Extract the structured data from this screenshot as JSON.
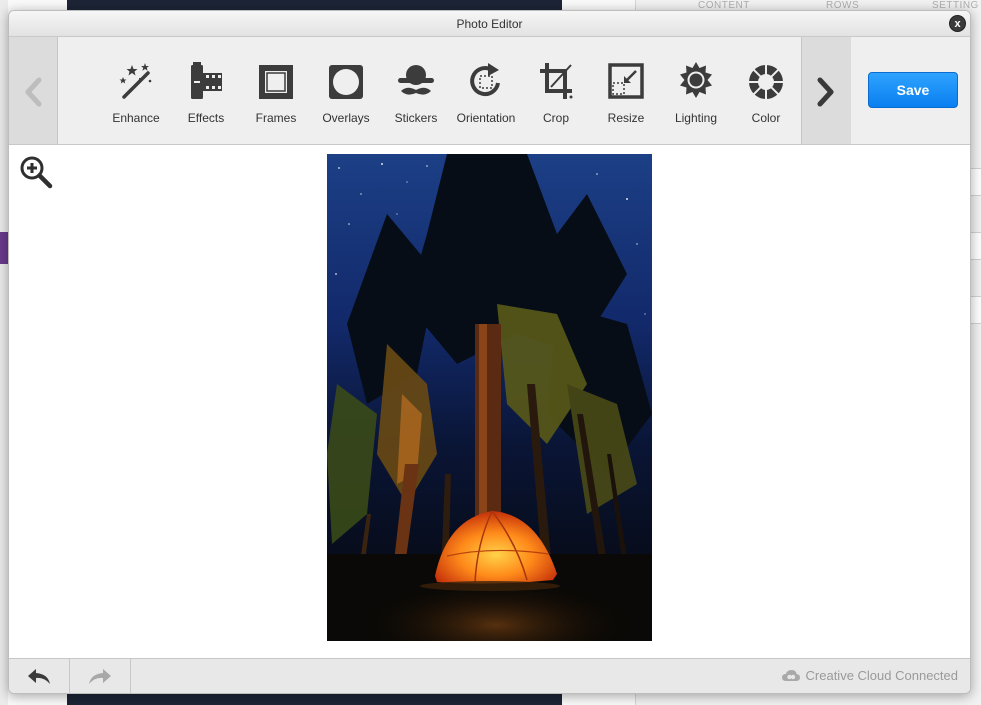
{
  "background": {
    "right_tabs": [
      "CONTENT",
      "ROWS",
      "SETTING"
    ]
  },
  "dialog": {
    "title": "Photo Editor",
    "close_label": "x"
  },
  "toolbar": {
    "tools": [
      {
        "label": "Enhance",
        "icon": "magic-wand-icon"
      },
      {
        "label": "Effects",
        "icon": "film-icon"
      },
      {
        "label": "Frames",
        "icon": "frame-icon"
      },
      {
        "label": "Overlays",
        "icon": "overlay-icon"
      },
      {
        "label": "Stickers",
        "icon": "sticker-hat-mustache-icon"
      },
      {
        "label": "Orientation",
        "icon": "rotate-icon"
      },
      {
        "label": "Crop",
        "icon": "crop-icon"
      },
      {
        "label": "Resize",
        "icon": "resize-icon"
      },
      {
        "label": "Lighting",
        "icon": "sun-icon"
      },
      {
        "label": "Color",
        "icon": "color-wheel-icon"
      }
    ],
    "save_label": "Save"
  },
  "status": {
    "cc_label": "Creative Cloud Connected"
  },
  "colors": {
    "save_button": "#0a84f5",
    "toolbar_bg": "#efefef",
    "icon": "#3c3c3c"
  }
}
